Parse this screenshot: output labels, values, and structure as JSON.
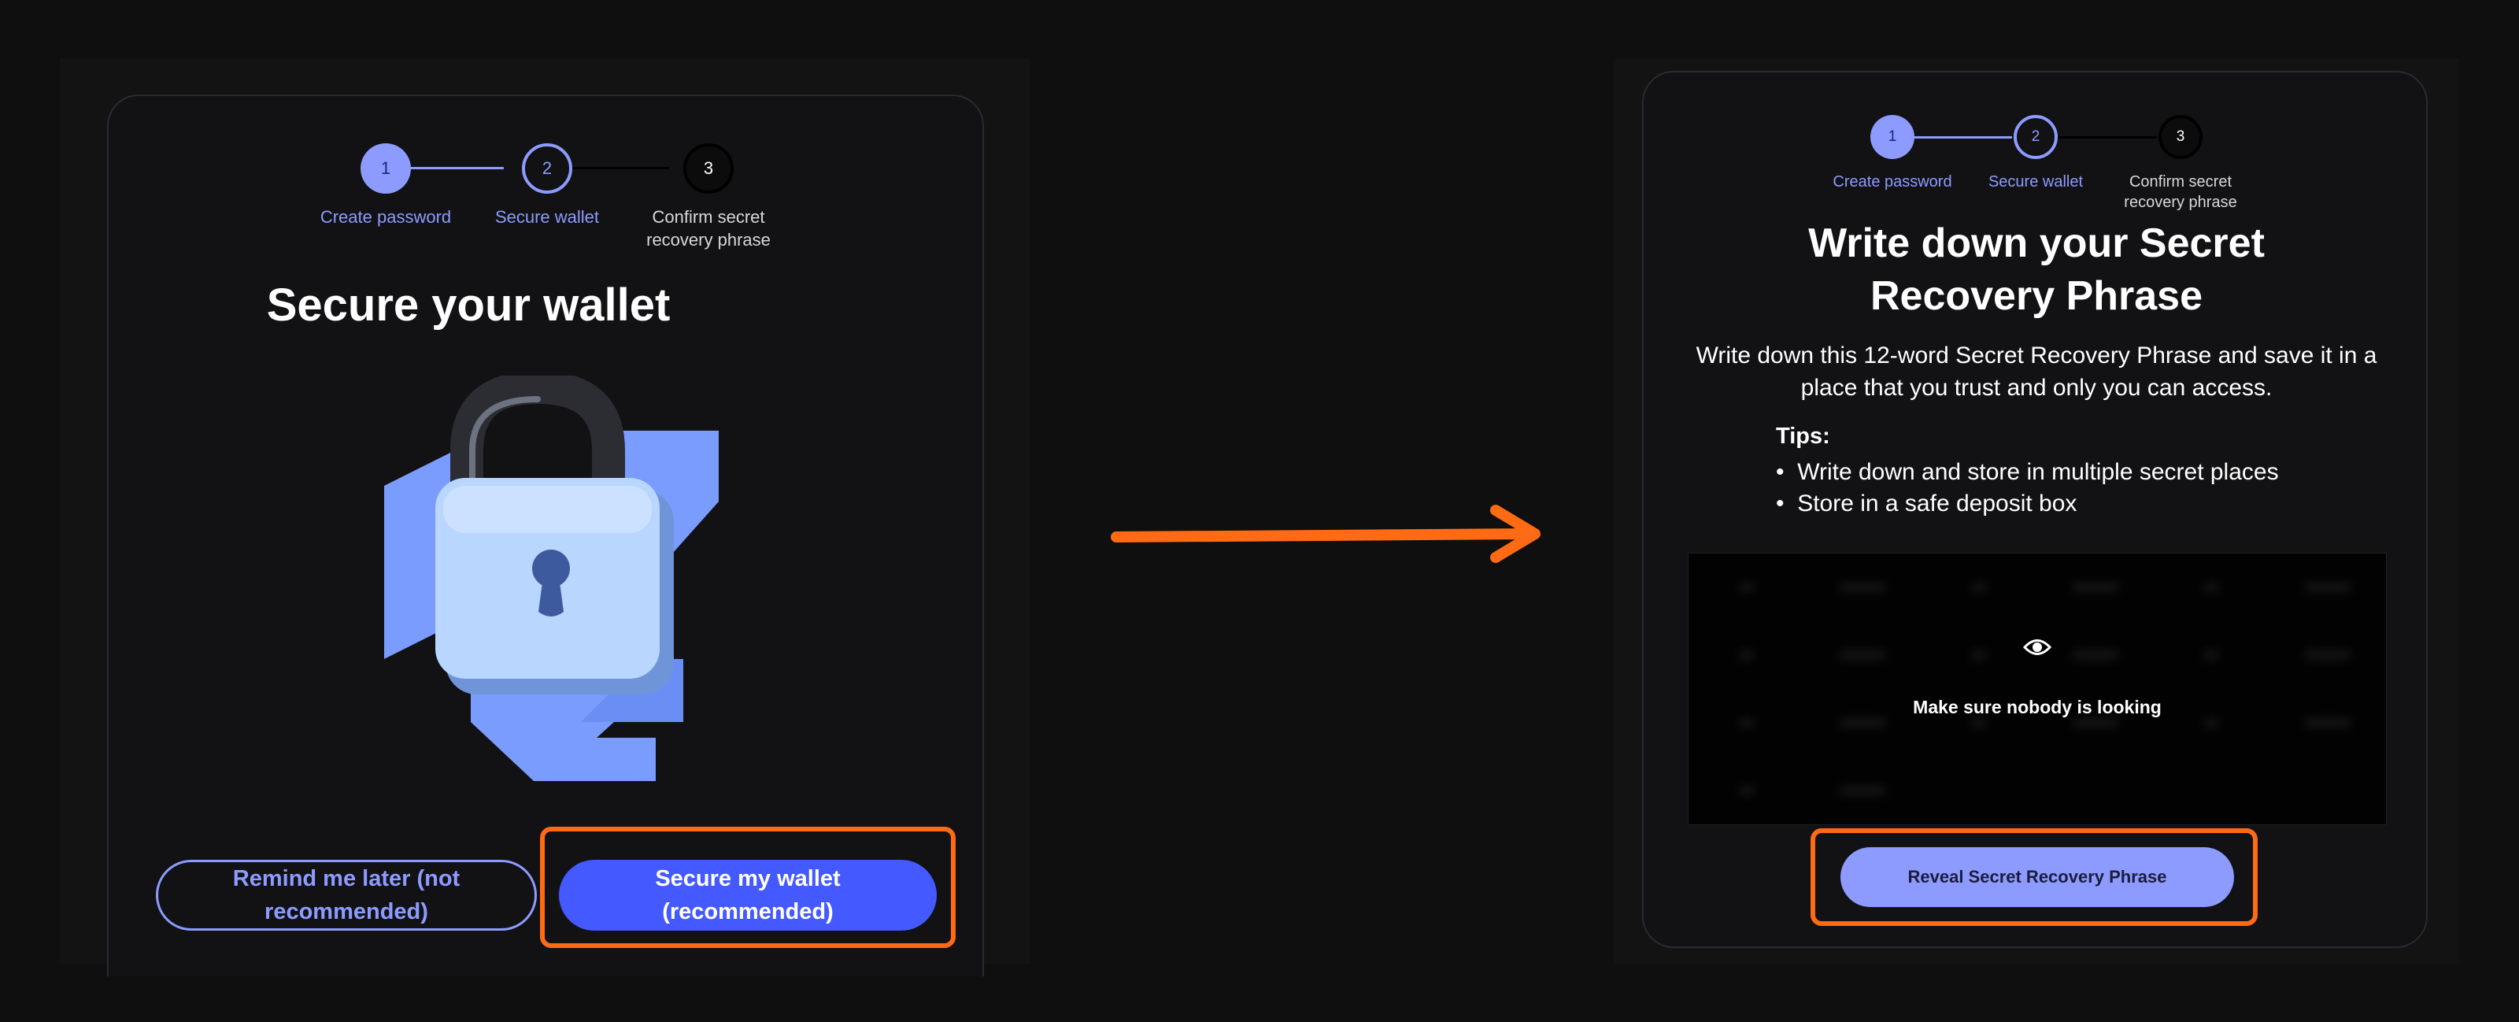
{
  "stepper": {
    "steps": [
      {
        "number": "1",
        "label": "Create password"
      },
      {
        "number": "2",
        "label": "Secure wallet"
      },
      {
        "number": "3",
        "label": "Confirm secret recovery phrase"
      }
    ]
  },
  "left_screen": {
    "title": "Secure your wallet",
    "illustration": "padlock-illustration",
    "buttons": {
      "remind_later": "Remind me later (not recommended)",
      "secure_wallet": "Secure my wallet (recommended)"
    }
  },
  "arrow": {
    "icon": "right-arrow-icon",
    "color": "#ff6a14"
  },
  "right_screen": {
    "title": "Write down your Secret Recovery Phrase",
    "description": "Write down this 12-word Secret Recovery Phrase and save it in a place that you trust and only you can access.",
    "tips_heading": "Tips:",
    "tips": [
      "Write down and store in multiple secret places",
      "Store in a safe deposit box"
    ],
    "phrase_overlay_text": "Make sure nobody is looking",
    "phrase_overlay_icon": "eye-icon",
    "reveal_button": "Reveal Secret Recovery Phrase"
  },
  "colors": {
    "accent": "#8d9bff",
    "primary_button": "#4459ff",
    "highlight": "#ff6a14",
    "background": "#0f0f10"
  }
}
